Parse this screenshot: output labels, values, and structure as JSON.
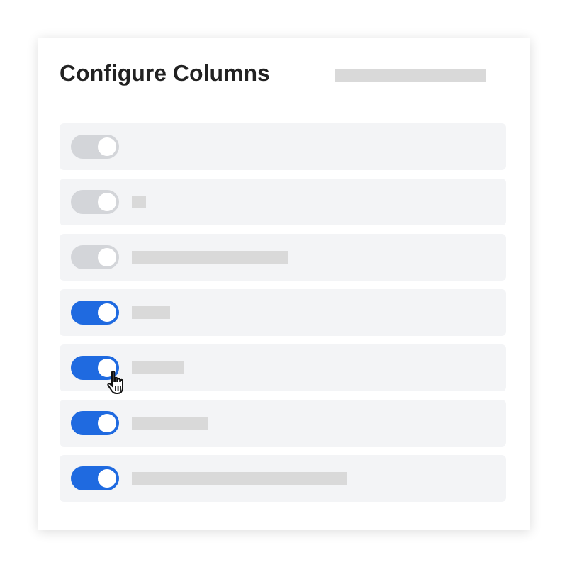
{
  "panel": {
    "title": "Configure Columns"
  },
  "columns": [
    {
      "on": true,
      "disabled": true
    },
    {
      "on": true,
      "disabled": true
    },
    {
      "on": true,
      "disabled": true
    },
    {
      "on": true
    },
    {
      "on": true,
      "hovered": true
    },
    {
      "on": true
    },
    {
      "on": true
    }
  ]
}
